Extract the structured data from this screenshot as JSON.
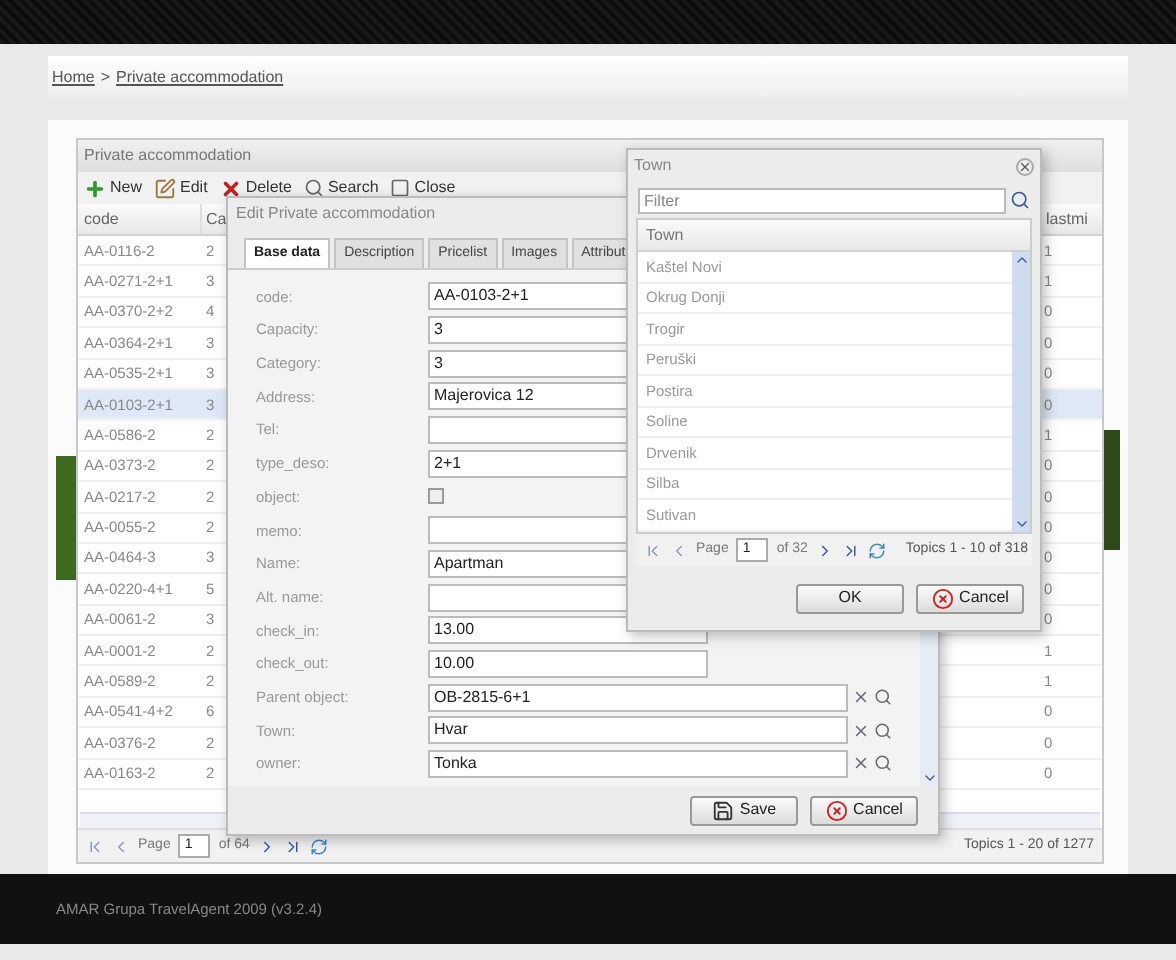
{
  "breadcrumb": {
    "items": [
      "Home",
      "Private accommodation"
    ],
    "separator": ">"
  },
  "grid": {
    "title": "Private accommodation",
    "toolbar": [
      {
        "label": "New",
        "kind": "new"
      },
      {
        "label": "Edit",
        "kind": "edit"
      },
      {
        "label": "Delete",
        "kind": "delete"
      },
      {
        "label": "Search",
        "kind": "search"
      },
      {
        "label": "Close",
        "kind": "close"
      }
    ],
    "columns": [
      "code",
      "Ca",
      "lastmi"
    ],
    "rows": [
      {
        "code": "AA-0116-2",
        "category": "2",
        "lastminute": "1",
        "selected": false
      },
      {
        "code": "AA-0271-2+1",
        "category": "3",
        "lastminute": "1",
        "selected": false
      },
      {
        "code": "AA-0370-2+2",
        "category": "4",
        "lastminute": "0",
        "selected": false
      },
      {
        "code": "AA-0364-2+1",
        "category": "3",
        "lastminute": "0",
        "selected": false
      },
      {
        "code": "AA-0535-2+1",
        "category": "3",
        "lastminute": "0",
        "selected": false
      },
      {
        "code": "AA-0103-2+1",
        "category": "3",
        "lastminute": "0",
        "selected": true
      },
      {
        "code": "AA-0586-2",
        "category": "2",
        "lastminute": "1",
        "selected": false
      },
      {
        "code": "AA-0373-2",
        "category": "2",
        "lastminute": "0",
        "selected": false
      },
      {
        "code": "AA-0217-2",
        "category": "2",
        "lastminute": "0",
        "selected": false
      },
      {
        "code": "AA-0055-2",
        "category": "2",
        "lastminute": "0",
        "selected": false
      },
      {
        "code": "AA-0464-3",
        "category": "3",
        "lastminute": "0",
        "selected": false
      },
      {
        "code": "AA-0220-4+1",
        "category": "5",
        "lastminute": "0",
        "selected": false
      },
      {
        "code": "AA-0061-2",
        "category": "3",
        "lastminute": "0",
        "selected": false
      },
      {
        "code": "AA-0001-2",
        "category": "2",
        "lastminute": "1",
        "selected": false
      },
      {
        "code": "AA-0589-2",
        "category": "2",
        "lastminute": "1",
        "selected": false
      },
      {
        "code": "AA-0541-4+2",
        "category": "6",
        "lastminute": "0",
        "selected": false
      },
      {
        "code": "AA-0376-2",
        "category": "2",
        "lastminute": "0",
        "selected": false
      },
      {
        "code": "AA-0163-2",
        "category": "2",
        "lastminute": "0",
        "selected": false
      }
    ],
    "pager": {
      "page_label": "Page",
      "page": "1",
      "of": "of 64",
      "topics": "Topics 1 - 20 of 1277"
    }
  },
  "edit_dialog": {
    "title": "Edit Private accommodation",
    "tabs": [
      {
        "label": "Base data",
        "selected": true
      },
      {
        "label": "Description",
        "selected": false
      },
      {
        "label": "Pricelist",
        "selected": false
      },
      {
        "label": "Images",
        "selected": false
      },
      {
        "label": "Attribut",
        "selected": false
      }
    ],
    "fields": [
      {
        "label": "code:",
        "kind": "text",
        "value": "AA-0103-2+1"
      },
      {
        "label": "Capacity:",
        "kind": "text",
        "value": "3"
      },
      {
        "label": "Category:",
        "kind": "text",
        "value": "3"
      },
      {
        "label": "Address:",
        "kind": "text",
        "value": "Majerovica 12"
      },
      {
        "label": "Tel:",
        "kind": "text"
      },
      {
        "label": "type_deso:",
        "kind": "text",
        "value": "2+1"
      },
      {
        "label": "object:",
        "kind": "checkbox",
        "checked": false
      },
      {
        "label": "memo:",
        "kind": "text"
      },
      {
        "label": "Name:",
        "kind": "text",
        "value": "Apartman"
      },
      {
        "label": "Alt. name:",
        "kind": "text"
      },
      {
        "label": "check_in:",
        "kind": "text",
        "value": "13.00"
      },
      {
        "label": "check_out:",
        "kind": "text",
        "value": "10.00"
      },
      {
        "label": "Parent object:",
        "kind": "lookup",
        "value": "OB-2815-6+1"
      },
      {
        "label": "Town:",
        "kind": "lookup",
        "value": "Hvar"
      },
      {
        "label": "owner:",
        "kind": "lookup",
        "value": "Tonka"
      }
    ],
    "buttons": [
      {
        "label": "Save",
        "kind": "save"
      },
      {
        "label": "Cancel",
        "kind": "cancel"
      }
    ]
  },
  "town_dialog": {
    "title": "Town",
    "filter_placeholder": "Filter",
    "column": "Town",
    "rows": [
      "Kaštel Novi",
      "Okrug Donji",
      "Trogir",
      "Peruški",
      "Postira",
      "Soline",
      "Drvenik",
      "Silba",
      "Sutivan"
    ],
    "pager": {
      "page_label": "Page",
      "page": "1",
      "of": "of 32",
      "topics": "Topics 1 - 10 of 318"
    },
    "buttons": [
      {
        "label": "OK",
        "kind": "ok"
      },
      {
        "label": "Cancel",
        "kind": "cancel"
      }
    ]
  },
  "footer": "AMAR Grupa TravelAgent 2009 (v3.2.4)"
}
